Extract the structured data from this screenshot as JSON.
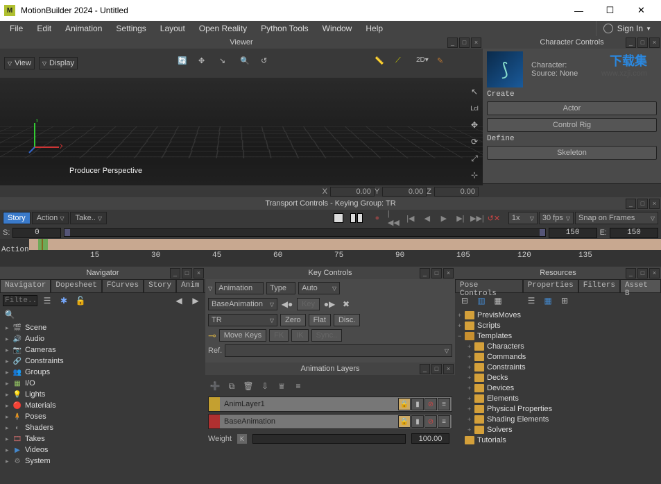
{
  "title": "MotionBuilder 2024 - Untitled",
  "menus": [
    "File",
    "Edit",
    "Animation",
    "Settings",
    "Layout",
    "Open Reality",
    "Python Tools",
    "Window",
    "Help"
  ],
  "signin": "Sign In",
  "viewer": {
    "title": "Viewer",
    "viewBtn": "View",
    "displayBtn": "Display",
    "perspectiveLabel": "Producer Perspective",
    "coords": {
      "x": "X",
      "xval": "0.00",
      "y": "Y",
      "yval": "0.00",
      "z": "Z",
      "zval": "0.00"
    }
  },
  "charCtrl": {
    "title": "Character Controls",
    "characterLabel": "Character:",
    "sourceLabel": "Source:",
    "sourceValue": "None",
    "createLabel": "Create",
    "actorBtn": "Actor",
    "rigBtn": "Control Rig",
    "defineLabel": "Define",
    "skeletonBtn": "Skeleton"
  },
  "watermark": {
    "name": "下载集",
    "url": "www.xzji.com"
  },
  "transport": {
    "title": "Transport Controls  -  Keying Group: TR",
    "storyTab": "Story",
    "actionTab": "Action",
    "takeLabel": "Take..",
    "rate": "1x",
    "fps": "30 fps",
    "snap": "Snap on Frames",
    "sLabel": "S:",
    "sVal": "0",
    "eLabel": "E:",
    "eVal": "150",
    "eTrack": "150",
    "rulerLabel": "Action",
    "ticks": [
      "15",
      "30",
      "45",
      "60",
      "75",
      "90",
      "105",
      "120",
      "135"
    ]
  },
  "navigator": {
    "title": "Navigator",
    "tabs": [
      "Navigator",
      "Dopesheet",
      "FCurves",
      "Story",
      "Anim"
    ],
    "filterPlaceholder": "Filte..",
    "tree": [
      {
        "icon": "🎬",
        "label": "Scene",
        "color": "#fff"
      },
      {
        "icon": "🔊",
        "label": "Audio",
        "color": "#78b"
      },
      {
        "icon": "📷",
        "label": "Cameras",
        "color": "#558"
      },
      {
        "icon": "🔗",
        "label": "Constraints",
        "color": "#c63"
      },
      {
        "icon": "👥",
        "label": "Groups",
        "color": "#c84"
      },
      {
        "icon": "▦",
        "label": "I/O",
        "color": "#9c6"
      },
      {
        "icon": "💡",
        "label": "Lights",
        "color": "#fc4"
      },
      {
        "icon": "🔴",
        "label": "Materials",
        "color": "#c44"
      },
      {
        "icon": "🧍",
        "label": "Poses",
        "color": "#b84"
      },
      {
        "icon": "◐",
        "label": "Shaders",
        "color": "#888"
      },
      {
        "icon": "🎞",
        "label": "Takes",
        "color": "#b66"
      },
      {
        "icon": "▶",
        "label": "Videos",
        "color": "#48c"
      },
      {
        "icon": "⚙",
        "label": "System",
        "color": "#888"
      }
    ]
  },
  "keyControls": {
    "title": "Key Controls",
    "animation": "Animation",
    "typeLabel": "Type",
    "typeValue": "Auto",
    "base": "BaseAnimation",
    "keyLabel": "Key",
    "tr": "TR",
    "zero": "Zero",
    "flat": "Flat",
    "disc": "Disc.",
    "moveKeys": "Move Keys",
    "fk": "FK",
    "ik": "IK",
    "sync": "Sync..",
    "refLabel": "Ref."
  },
  "animLayers": {
    "title": "Animation Layers",
    "layers": [
      {
        "name": "AnimLayer1",
        "color": "#c4a030"
      },
      {
        "name": "BaseAnimation",
        "color": "#b03030"
      }
    ],
    "weightLabel": "Weight",
    "weightValue": "100.00"
  },
  "resources": {
    "title": "Resources",
    "tabs": [
      "Pose Controls",
      "Properties",
      "Filters",
      "Asset B"
    ],
    "tree": [
      {
        "lvl": 0,
        "exp": "+",
        "label": "PrevisMoves"
      },
      {
        "lvl": 0,
        "exp": "+",
        "label": "Scripts"
      },
      {
        "lvl": 0,
        "exp": "−",
        "label": "Templates",
        "open": true
      },
      {
        "lvl": 1,
        "exp": "+",
        "label": "Characters"
      },
      {
        "lvl": 1,
        "exp": "+",
        "label": "Commands"
      },
      {
        "lvl": 1,
        "exp": "+",
        "label": "Constraints"
      },
      {
        "lvl": 1,
        "exp": "+",
        "label": "Decks"
      },
      {
        "lvl": 1,
        "exp": "+",
        "label": "Devices"
      },
      {
        "lvl": 1,
        "exp": "+",
        "label": "Elements"
      },
      {
        "lvl": 1,
        "exp": "+",
        "label": "Physical Properties"
      },
      {
        "lvl": 1,
        "exp": "+",
        "label": "Shading Elements"
      },
      {
        "lvl": 1,
        "exp": "+",
        "label": "Solvers"
      },
      {
        "lvl": 0,
        "exp": "",
        "label": "Tutorials"
      }
    ]
  }
}
